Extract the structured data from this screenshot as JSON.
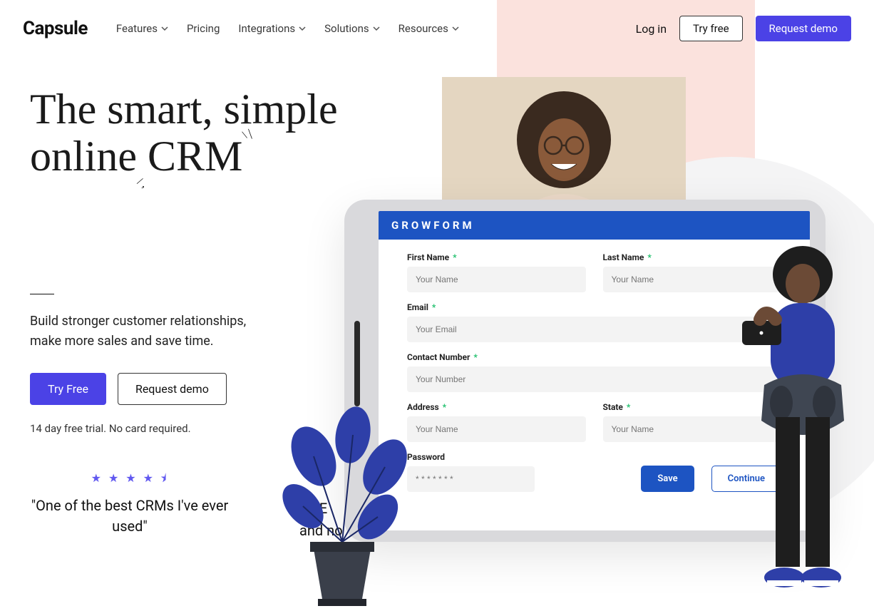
{
  "brand": "Capsule",
  "nav": {
    "items": [
      {
        "label": "Features",
        "has_menu": true
      },
      {
        "label": "Pricing",
        "has_menu": false
      },
      {
        "label": "Integrations",
        "has_menu": true
      },
      {
        "label": "Solutions",
        "has_menu": true
      },
      {
        "label": "Resources",
        "has_menu": true
      }
    ]
  },
  "header_actions": {
    "login": "Log in",
    "try_free": "Try free",
    "request_demo": "Request demo"
  },
  "hero": {
    "title_line1": "The smart, simple",
    "title_line2_prefix": "online ",
    "title_line2_word": "CRM",
    "subtitle": "Build stronger customer relationships, make more sales and save time.",
    "cta_primary": "Try Free",
    "cta_secondary": "Request demo",
    "trial_note": "14 day free trial. No card required."
  },
  "testimonials": {
    "stars": "★ ★ ★ ★ ⯨",
    "quote1": "\"One of the best CRMs I've ever used\"",
    "quote2_line1": "\"E",
    "quote2_line2": "and no"
  },
  "form": {
    "brand": "GROWFORM",
    "fields": {
      "first_name": {
        "label": "First Name",
        "placeholder": "Your Name",
        "required": true
      },
      "last_name": {
        "label": "Last Name",
        "placeholder": "Your Name",
        "required": true
      },
      "email": {
        "label": "Email",
        "placeholder": "Your Email",
        "required": true
      },
      "contact": {
        "label": "Contact Number",
        "placeholder": "Your Number",
        "required": true
      },
      "address": {
        "label": "Address",
        "placeholder": "Your Name",
        "required": true
      },
      "state": {
        "label": "State",
        "placeholder": "Your Name",
        "required": true
      },
      "password": {
        "label": "Password",
        "placeholder": "* * * * * * *",
        "required": false
      }
    },
    "actions": {
      "save": "Save",
      "continue": "Continue"
    }
  },
  "colors": {
    "primary_purple": "#4b42e6",
    "form_blue": "#1d54c2",
    "pink_bg": "#fbe2dd"
  }
}
